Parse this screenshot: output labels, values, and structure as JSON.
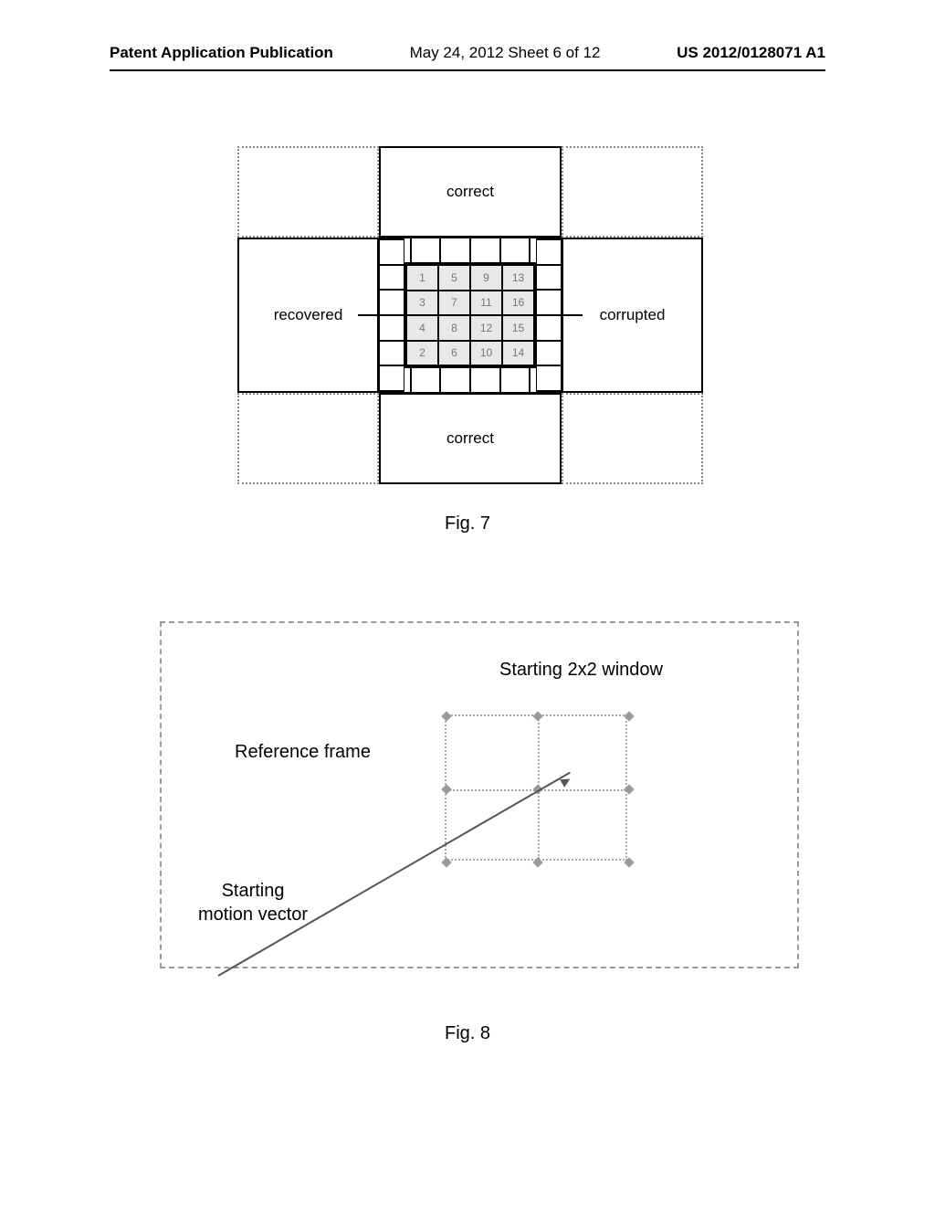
{
  "header": {
    "left": "Patent Application Publication",
    "center": "May 24, 2012  Sheet 6 of 12",
    "right": "US 2012/0128071 A1"
  },
  "fig7": {
    "caption": "Fig. 7",
    "labels": {
      "top": "correct",
      "bottom": "correct",
      "left": "recovered",
      "right": "corrupted"
    },
    "grid": [
      [
        "1",
        "5",
        "9",
        "13"
      ],
      [
        "3",
        "7",
        "11",
        "16"
      ],
      [
        "4",
        "8",
        "12",
        "15"
      ],
      [
        "2",
        "6",
        "10",
        "14"
      ]
    ]
  },
  "fig8": {
    "caption": "Fig. 8",
    "labels": {
      "starting_window": "Starting 2x2 window",
      "reference_frame": "Reference frame",
      "starting_mv_line1": "Starting",
      "starting_mv_line2": "motion vector"
    }
  }
}
